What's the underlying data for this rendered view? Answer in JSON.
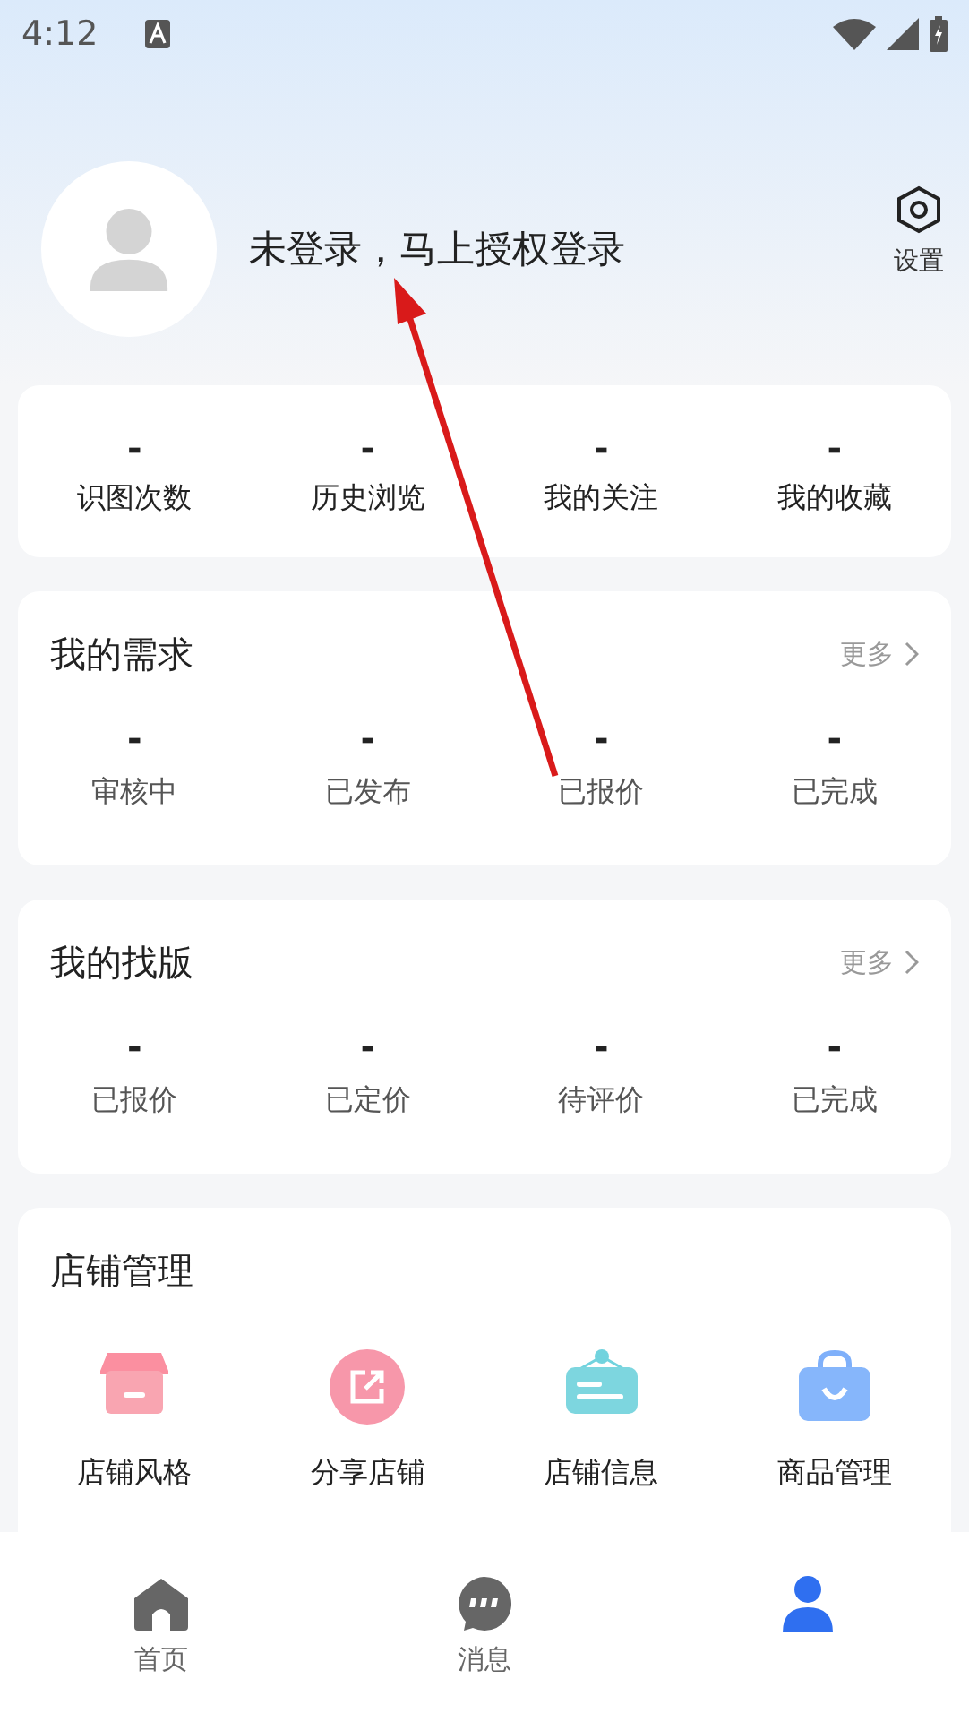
{
  "status_bar": {
    "time": "4:12"
  },
  "profile": {
    "login_prompt": "未登录，马上授权登录",
    "settings_label": "设置"
  },
  "stats": [
    {
      "value": "-",
      "label": "识图次数"
    },
    {
      "value": "-",
      "label": "历史浏览"
    },
    {
      "value": "-",
      "label": "我的关注"
    },
    {
      "value": "-",
      "label": "我的收藏"
    }
  ],
  "sections": [
    {
      "title": "我的需求",
      "more": "更多",
      "items": [
        {
          "value": "-",
          "label": "审核中"
        },
        {
          "value": "-",
          "label": "已发布"
        },
        {
          "value": "-",
          "label": "已报价"
        },
        {
          "value": "-",
          "label": "已完成"
        }
      ]
    },
    {
      "title": "我的找版",
      "more": "更多",
      "items": [
        {
          "value": "-",
          "label": "已报价"
        },
        {
          "value": "-",
          "label": "已定价"
        },
        {
          "value": "-",
          "label": "待评价"
        },
        {
          "value": "-",
          "label": "已完成"
        }
      ]
    }
  ],
  "shop": {
    "title": "店铺管理",
    "items": [
      {
        "kind": "store",
        "label": "店铺风格"
      },
      {
        "kind": "share",
        "label": "分享店铺"
      },
      {
        "kind": "sign",
        "label": "店铺信息"
      },
      {
        "kind": "bag",
        "label": "商品管理"
      }
    ]
  },
  "nav": [
    {
      "kind": "home",
      "label": "首页",
      "selected": false
    },
    {
      "kind": "chat",
      "label": "消息",
      "selected": false
    },
    {
      "kind": "user",
      "selected": true
    }
  ]
}
